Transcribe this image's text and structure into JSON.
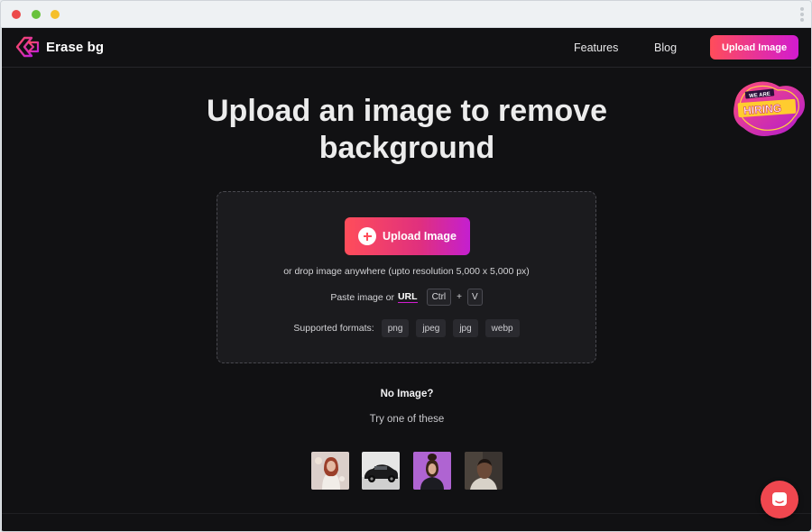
{
  "window": {
    "controls": [
      "close",
      "minimize",
      "maximize"
    ]
  },
  "nav": {
    "brand": "Erase bg",
    "links": [
      "Features",
      "Blog"
    ],
    "cta": "Upload Image"
  },
  "hero": {
    "title_line1": "Upload an image to remove",
    "title_line2": "background"
  },
  "badge": {
    "top": "WE ARE",
    "main": "HIRING"
  },
  "dropzone": {
    "button": "Upload Image",
    "hint": "or drop image anywhere (upto resolution 5,000 x 5,000 px)",
    "paste_text": "Paste image or",
    "url_link": "URL",
    "keys": [
      "Ctrl",
      "V"
    ],
    "plus": "+",
    "formats_label": "Supported formats:",
    "formats": [
      "png",
      "jpeg",
      "jpg",
      "webp"
    ]
  },
  "samples": {
    "heading": "No Image?",
    "subheading": "Try one of these",
    "items": [
      "woman-portrait",
      "black-car",
      "woman-purple-background",
      "man-portrait"
    ]
  },
  "colors": {
    "background": "#111113",
    "accent_start": "#ff4d5a",
    "accent_end": "#d21bd0",
    "chat": "#f0474f"
  },
  "icons": [
    "erase-bg-logo-icon",
    "plus-circle-icon",
    "chat-icon",
    "kebab-menu-icon"
  ]
}
